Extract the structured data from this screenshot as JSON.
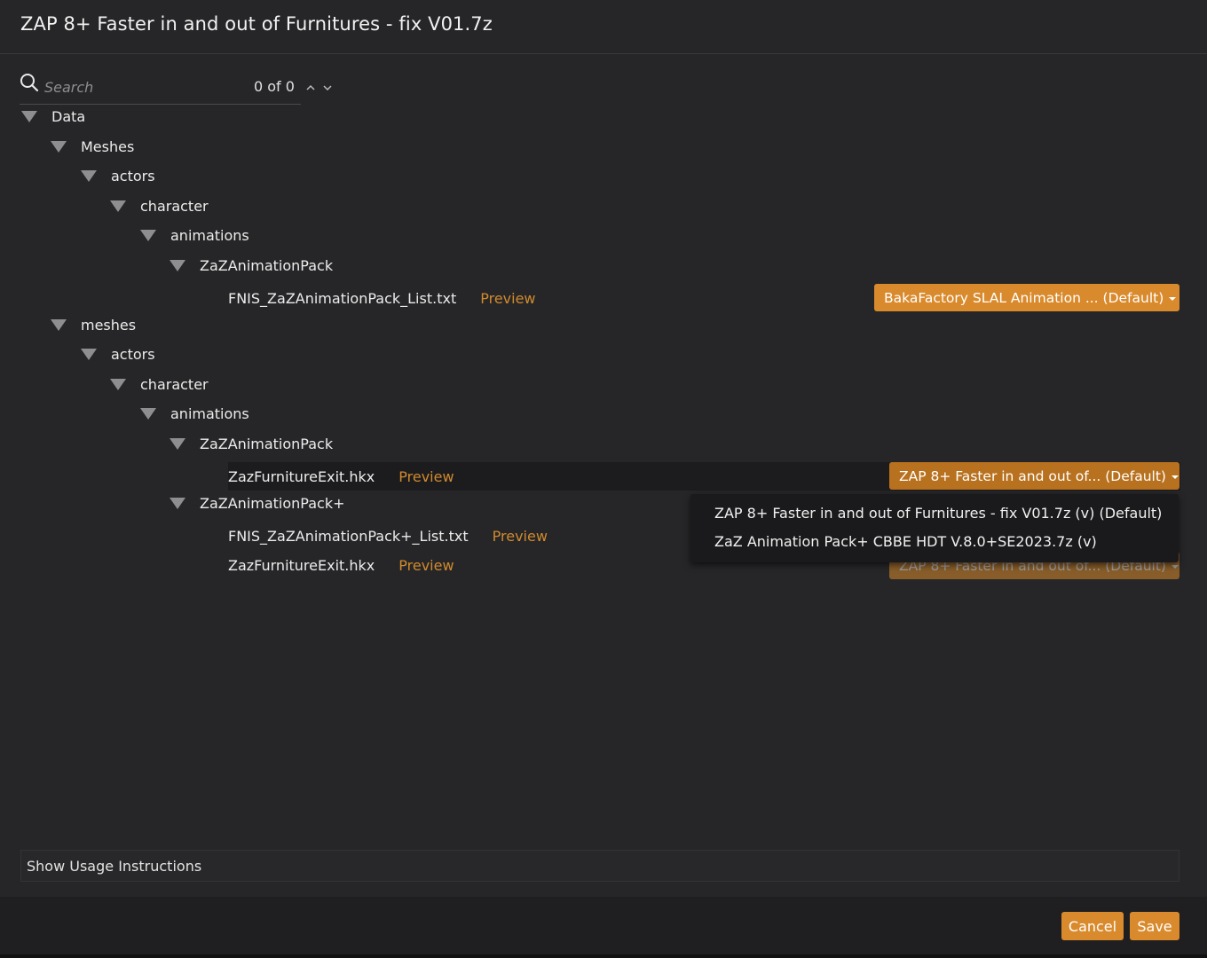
{
  "window": {
    "title": "ZAP 8+ Faster in and out of Furnitures - fix V01.7z"
  },
  "search": {
    "placeholder": "Search",
    "count": "0 of 0",
    "icon": "search-icon"
  },
  "tree": {
    "n0": "Data",
    "n1": "Meshes",
    "n2": "actors",
    "n3": "character",
    "n4": "animations",
    "n5": "ZaZAnimationPack",
    "n6": "meshes",
    "n7": "actors",
    "n8": "character",
    "n9": "animations",
    "n10": "ZaZAnimationPack",
    "n11": "ZaZAnimationPack+"
  },
  "files": {
    "f1": {
      "name": "FNIS_ZaZAnimationPack_List.txt",
      "preview": "Preview",
      "mod": "BakaFactory SLAL Animation ... (Default)"
    },
    "f2": {
      "name": "ZazFurnitureExit.hkx",
      "preview": "Preview",
      "mod": "ZAP 8+ Faster in and out of... (Default)"
    },
    "f3": {
      "name": "FNIS_ZaZAnimationPack+_List.txt",
      "preview": "Preview"
    },
    "f4": {
      "name": "ZazFurnitureExit.hkx",
      "preview": "Preview",
      "mod": "ZAP 8+ Faster in and out of... (Default)"
    }
  },
  "dropdown": {
    "options": [
      "ZAP 8+ Faster in and out of Furnitures - fix V01.7z (v) (Default)",
      "ZaZ Animation Pack+ CBBE HDT V.8.0+SE2023.7z (v)"
    ]
  },
  "usage": {
    "label": "Show Usage Instructions"
  },
  "footer": {
    "cancel": "Cancel",
    "save": "Save"
  },
  "colors": {
    "accent": "#d98a2c",
    "preview": "#d08a2e",
    "background": "#262628",
    "footer": "#1f1f21"
  }
}
